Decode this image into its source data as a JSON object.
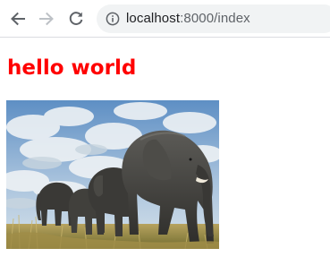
{
  "browser": {
    "url_host": "localhost",
    "url_path": ":8000/index",
    "icons": {
      "back": "arrow-left-icon",
      "forward": "arrow-right-icon",
      "reload": "reload-icon",
      "site_info": "info-icon"
    },
    "colors": {
      "icon": "#5f6368",
      "icon_disabled": "#bdc1c6",
      "omnibox_bg": "#f1f3f4"
    }
  },
  "page": {
    "heading": "hello world",
    "heading_color": "#ff0000",
    "image_subject": "elephants-photo"
  }
}
